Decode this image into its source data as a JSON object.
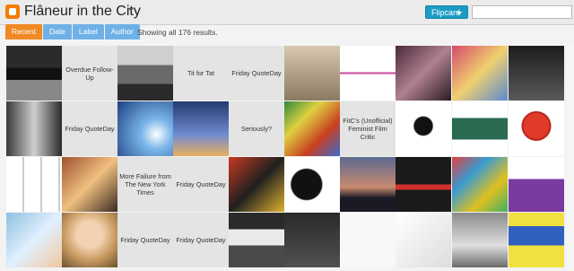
{
  "header": {
    "blog_title": "Flâneur in the City",
    "view_select": "Flipcard",
    "search_value": ""
  },
  "tabs": [
    {
      "label": "Recent",
      "active": true
    },
    {
      "label": "Date",
      "active": false
    },
    {
      "label": "Label",
      "active": false
    },
    {
      "label": "Author",
      "active": false
    }
  ],
  "results_text": "Showing all 176 results.",
  "grid": [
    [
      {
        "type": "image",
        "subject": "street-sign-photo"
      },
      {
        "type": "text",
        "text": "Overdue Follow-Up"
      },
      {
        "type": "image",
        "subject": "parked-car-photo"
      },
      {
        "type": "text",
        "text": "Tit for Tat"
      },
      {
        "type": "text",
        "text": "Friday QuoteDay"
      },
      {
        "type": "image",
        "subject": "sign-photo"
      },
      {
        "type": "image",
        "subject": "symbols-infographic"
      },
      {
        "type": "image",
        "subject": "hands-artwork"
      },
      {
        "type": "image",
        "subject": "magazine-covers"
      },
      {
        "type": "image",
        "subject": "tablet-photo"
      }
    ],
    [
      {
        "type": "image",
        "subject": "building-window-photo"
      },
      {
        "type": "text",
        "text": "Friday QuoteDay"
      },
      {
        "type": "image",
        "subject": "blue-sky-lamp-photo"
      },
      {
        "type": "image",
        "subject": "sunset-street-lamp-photo"
      },
      {
        "type": "text",
        "text": "Seriously?"
      },
      {
        "type": "image",
        "subject": "comic-book-collage"
      },
      {
        "type": "text",
        "text": "FitC's (Unofficial) Feminist Film Critic"
      },
      {
        "type": "image",
        "subject": "cartoon-woman-illustration"
      },
      {
        "type": "image",
        "subject": "photography-ad"
      },
      {
        "type": "image",
        "subject": "red-button-icon"
      }
    ],
    [
      {
        "type": "image",
        "subject": "cartoon-strip"
      },
      {
        "type": "image",
        "subject": "movie-stills"
      },
      {
        "type": "text",
        "text": "More Failure from The New York Times"
      },
      {
        "type": "text",
        "text": "Friday QuoteDay"
      },
      {
        "type": "image",
        "subject": "movie-poster-collage"
      },
      {
        "type": "image",
        "subject": "newspaper-masthead"
      },
      {
        "type": "image",
        "subject": "city-skyline-sunset-photo"
      },
      {
        "type": "image",
        "subject": "comic-quote-panel"
      },
      {
        "type": "image",
        "subject": "graffiti-wall-photo"
      },
      {
        "type": "image",
        "subject": "iwd-hands-graphic"
      }
    ],
    [
      {
        "type": "image",
        "subject": "watercolor-painting"
      },
      {
        "type": "image",
        "subject": "woman-portrait-photo"
      },
      {
        "type": "text",
        "text": "Friday QuoteDay"
      },
      {
        "type": "text",
        "text": "Friday QuoteDay"
      },
      {
        "type": "image",
        "subject": "protest-sign-photo"
      },
      {
        "type": "image",
        "subject": "chalkboard-photo"
      },
      {
        "type": "image",
        "subject": "share-post-graphic"
      },
      {
        "type": "image",
        "subject": "london-map"
      },
      {
        "type": "image",
        "subject": "drawing-in-gallery"
      },
      {
        "type": "image",
        "subject": "feminism-poster"
      }
    ]
  ],
  "colors": {
    "tab_active": "#f08a24",
    "tab_inactive": "#6fb1e6",
    "view_select": "#1c9cc3",
    "logo": "#f57d00"
  }
}
